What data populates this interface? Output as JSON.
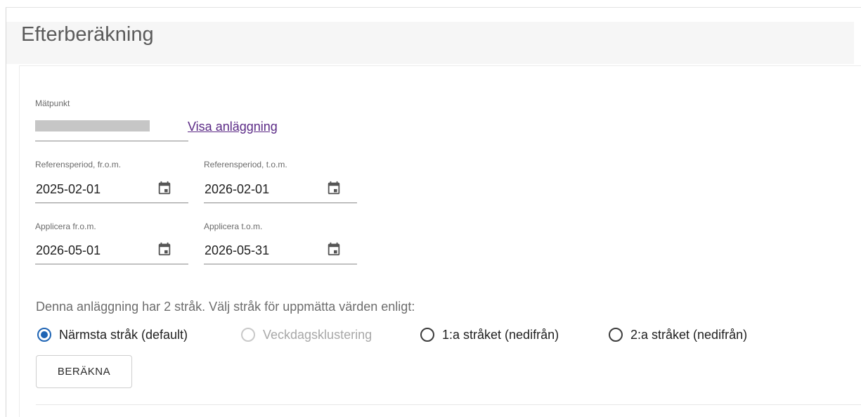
{
  "page": {
    "title": "Efterberäkning"
  },
  "measurement_point": {
    "label": "Mätpunkt",
    "link_label": "Visa anläggning"
  },
  "reference_period": {
    "from": {
      "label": "Referensperiod, fr.o.m.",
      "value": "2025-02-01"
    },
    "to": {
      "label": "Referensperiod, t.o.m.",
      "value": "2026-02-01"
    }
  },
  "apply_period": {
    "from": {
      "label": "Applicera fr.o.m.",
      "value": "2026-05-01"
    },
    "to": {
      "label": "Applicera t.o.m.",
      "value": "2026-05-31"
    }
  },
  "lane_selection": {
    "info": "Denna anläggning har 2 stråk. Välj stråk för uppmätta värden enligt:",
    "options": [
      {
        "label": "Närmsta stråk (default)",
        "state": "checked"
      },
      {
        "label": "Veckdagsklustering",
        "state": "disabled"
      },
      {
        "label": "1:a stråket (nedifrån)",
        "state": "unchecked"
      },
      {
        "label": "2:a stråket (nedifrån)",
        "state": "unchecked"
      }
    ]
  },
  "actions": {
    "calculate_label": "BERÄKNA"
  },
  "icons": {
    "date_picker": "calendar-icon"
  },
  "colors": {
    "accent": "#1e64b4",
    "link": "#5b2a86"
  }
}
